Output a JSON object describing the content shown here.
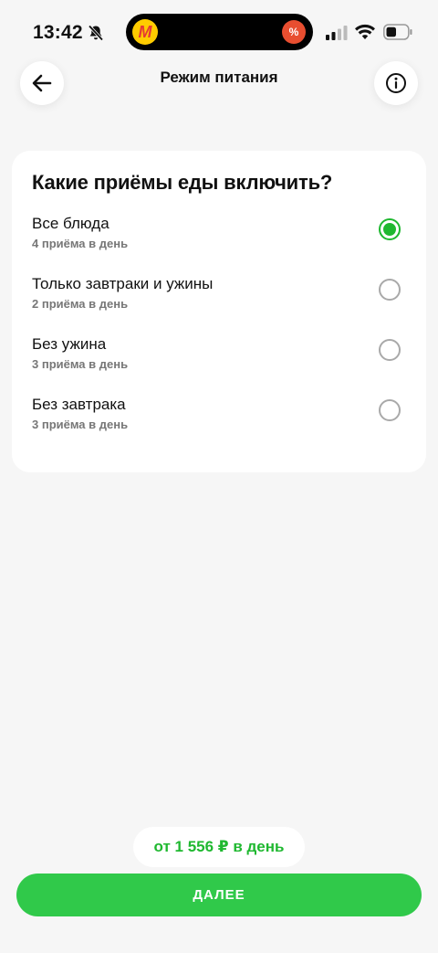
{
  "status_bar": {
    "time": "13:42",
    "promo_icon": "%"
  },
  "header": {
    "title": "Режим питания"
  },
  "card": {
    "title": "Какие приёмы еды включить?",
    "options": [
      {
        "label": "Все блюда",
        "sub": "4 приёма в день",
        "selected": true
      },
      {
        "label": "Только завтраки и ужины",
        "sub": "2 приёма в день",
        "selected": false
      },
      {
        "label": "Без ужина",
        "sub": "3 приёма в день",
        "selected": false
      },
      {
        "label": "Без завтрака",
        "sub": "3 приёма в день",
        "selected": false
      }
    ]
  },
  "footer": {
    "price": "от 1 556 ₽ в день",
    "next_label": "ДАЛЕЕ"
  },
  "colors": {
    "accent": "#30c94a",
    "price_text": "#1fb830",
    "background": "#f6f6f6"
  }
}
